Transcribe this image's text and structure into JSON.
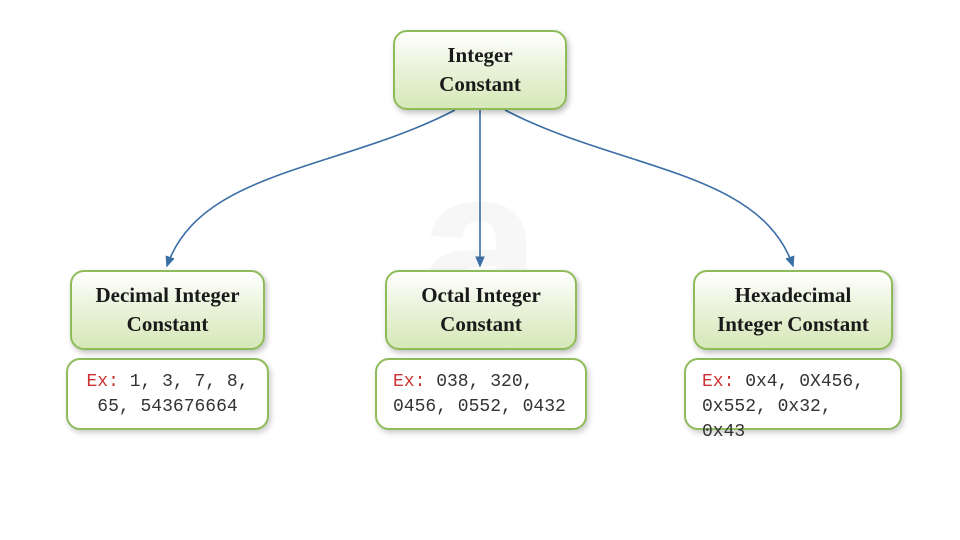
{
  "root": {
    "line1": "Integer",
    "line2": "Constant"
  },
  "children": [
    {
      "title_line1": "Decimal Integer",
      "title_line2": "Constant",
      "ex_label": "Ex:",
      "ex_text": " 1, 3, 7, 8, 65, 543676664"
    },
    {
      "title_line1": "Octal Integer",
      "title_line2": "Constant",
      "ex_label": "Ex:",
      "ex_text": " 038, 320, 0456, 0552, 0432"
    },
    {
      "title_line1": "Hexadecimal",
      "title_line2": "Integer Constant",
      "ex_label": "Ex:",
      "ex_text": " 0x4, 0X456, 0x552, 0x32, 0x43"
    }
  ],
  "watermark": "a",
  "colors": {
    "border": "#8fbc5a",
    "arrow": "#3a6ea5",
    "ex_label": "#cc3333"
  }
}
